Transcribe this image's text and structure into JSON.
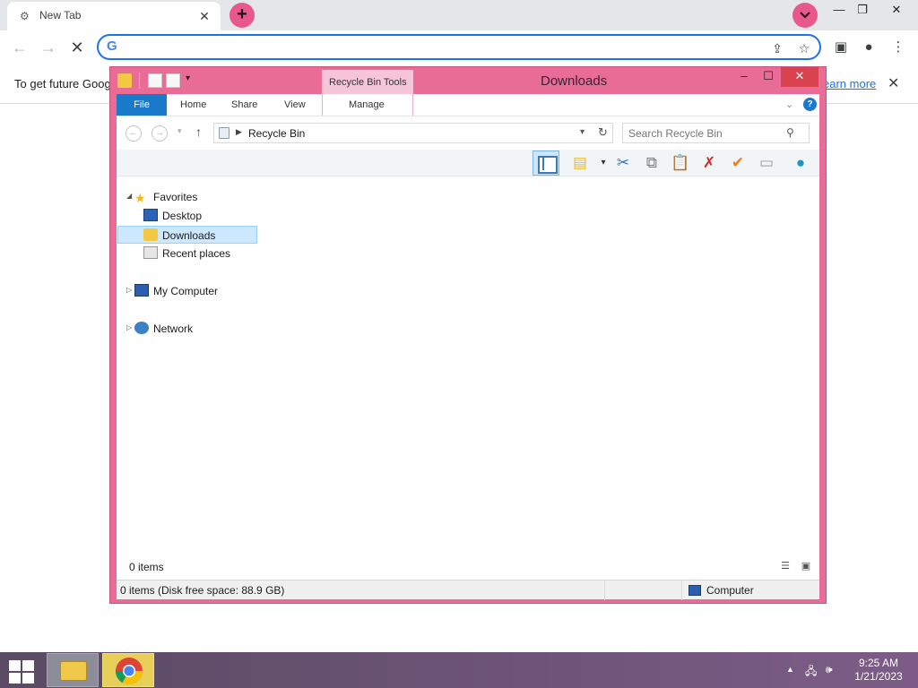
{
  "browser": {
    "tab_title": "New Tab",
    "omnibox_value": "",
    "infobar_message": "To get future Goog",
    "infobar_link": "earn more"
  },
  "explorer": {
    "title": "Downloads",
    "contextual_tab": "Recycle Bin Tools",
    "ribbon_tabs": [
      "File",
      "Home",
      "Share",
      "View",
      "Manage"
    ],
    "address": "Recycle Bin",
    "search_placeholder": "Search Recycle Bin",
    "nav": {
      "favorites": "Favorites",
      "desktop": "Desktop",
      "downloads": "Downloads",
      "recent": "Recent places",
      "my_computer": "My Computer",
      "network": "Network"
    },
    "item_count": "0 items",
    "status_left": "0 items (Disk free space: 88.9 GB)",
    "status_right": "Computer"
  },
  "taskbar": {
    "time": "9:25 AM",
    "date": "1/21/2023"
  },
  "colors": {
    "window_frame": "#e86c96",
    "accent_blue": "#1979ca",
    "selection": "#cce8ff"
  }
}
